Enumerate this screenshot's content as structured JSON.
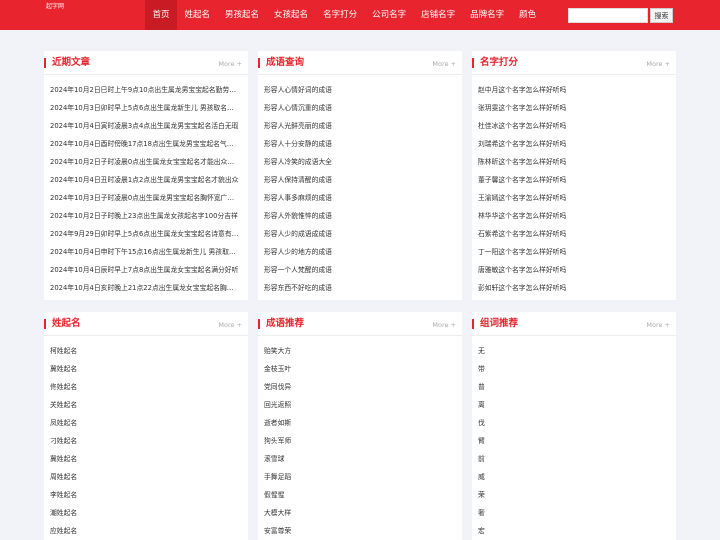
{
  "header": {
    "logo": "起字网",
    "nav": [
      "首页",
      "姓起名",
      "男孩起名",
      "女孩起名",
      "名字打分",
      "公司名字",
      "店铺名字",
      "品牌名字",
      "颜色"
    ],
    "search_placeholder": "",
    "search_button": "搜索"
  },
  "colors": {
    "brand": "#e8252f",
    "nav_active": "#c81b24",
    "background": "#f1f3f8"
  },
  "panels": {
    "recent": {
      "title": "近期文章",
      "more": "More +",
      "items": [
        "2024年10月2日巳时上午9点10点出生属龙男宝宝起名勤劳勇敢",
        "2024年10月3日卯时早上5点6点出生属龙新生儿 男孩取名字大全",
        "2024年10月4日寅时凌晨3点4点出生属龙男宝宝起名活白无瑕",
        "2024年10月4日酉时傍晚17点18点出生属龙男宝宝起名气质非凡",
        "2024年10月2日子时凌晨0点出生属龙女宝宝起名才能出众的名字",
        "2024年10月4日丑时凌晨1点2点出生属龙男宝宝起名才貌出众",
        "2024年10月3日子时凌晨0点出生属龙男宝宝起名胸怀宽广的名字",
        "2024年10月2日子时晚上23点出生属龙女孩起名字100分吉祥",
        "2024年9月29日卯时早上5点6点出生属龙女宝宝起名诗意有涵养",
        "2024年10月4日申时下午15点16点出生属龙新生儿 男孩取名字大全",
        "2024年10月4日辰时早上7点8点出生属龙女宝宝起名满分好听",
        "2024年10月4日亥时晚上21点22点出生属龙女宝宝起名胸怀宽广"
      ]
    },
    "idioms": {
      "title": "成语查询",
      "more": "More +",
      "items": [
        "形容人心情好词的成语",
        "形容人心情沉重的成语",
        "形容人光鲜亮丽的成语",
        "形容人十分安静的成语",
        "形容人冷笑的成语大全",
        "形容人保持清醒的成语",
        "形容人事多麻烦的成语",
        "形容人外貌惟悴的成语",
        "形容人少的成语成成语",
        "形容人少的地方的成语",
        "形容一个人梵醒的成语",
        "形容东西不好吃的成语"
      ]
    },
    "score": {
      "title": "名字打分",
      "more": "More +",
      "items": [
        "赵中月这个名字怎么样好听吗",
        "张玥雯这个名字怎么样好听吗",
        "杜佳冰这个名字怎么样好听吗",
        "刘瑞希这个名字怎么样好听吗",
        "陈林昕这个名字怎么样好听吗",
        "董子馨这个名字怎么样好听吗",
        "王渝嫣这个名字怎么样好听吗",
        "林华华这个名字怎么样好听吗",
        "石紫希这个名字怎么样好听吗",
        "丁一阳这个名字怎么样好听吗",
        "唐雅敏这个名字怎么样好听吗",
        "彭如轩这个名字怎么样好听吗"
      ]
    },
    "surname": {
      "title": "姓起名",
      "more": "More +",
      "items": [
        "柯姓起名",
        "冀姓起名",
        "佟姓起名",
        "关姓起名",
        "凤姓起名",
        "刁姓起名",
        "冀姓起名",
        "周姓起名",
        "李姓起名",
        "潮姓起名",
        "应姓起名"
      ]
    },
    "idiom_rec": {
      "title": "成语推荐",
      "more": "More +",
      "items": [
        "贻笑大方",
        "金枝玉叶",
        "党同伐异",
        "回光返照",
        "逝者如斯",
        "狗头军师",
        "滚雪球",
        "手舞足蹈",
        "假惺惺",
        "大模大样",
        "安富尊荣"
      ]
    },
    "word_rec": {
      "title": "组词推荐",
      "more": "More +",
      "items": [
        "无",
        "带",
        "普",
        "离",
        "伐",
        "臂",
        "前",
        "威",
        "荣",
        "奢",
        "宏"
      ]
    }
  }
}
